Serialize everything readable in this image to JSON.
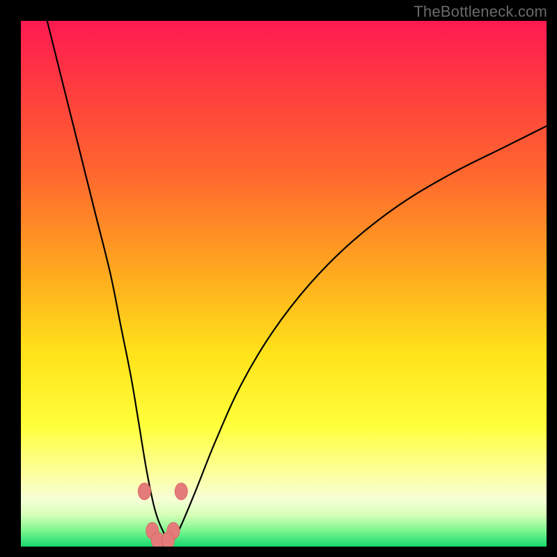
{
  "watermark": "TheBottleneck.com",
  "colors": {
    "frame": "#000000",
    "curve": "#000000",
    "marker_fill": "#e27b79",
    "marker_stroke": "#dc6866",
    "grad_stops": [
      {
        "pct": 0,
        "color": "#ff1a52"
      },
      {
        "pct": 14,
        "color": "#ff3f3d"
      },
      {
        "pct": 30,
        "color": "#ff6a2e"
      },
      {
        "pct": 48,
        "color": "#ffaa1e"
      },
      {
        "pct": 63,
        "color": "#ffe21a"
      },
      {
        "pct": 77,
        "color": "#ffff3a"
      },
      {
        "pct": 86,
        "color": "#fdff9c"
      },
      {
        "pct": 91,
        "color": "#f6ffd6"
      },
      {
        "pct": 94,
        "color": "#d6ffb7"
      },
      {
        "pct": 97,
        "color": "#7cf58f"
      },
      {
        "pct": 100,
        "color": "#16d96e"
      }
    ]
  },
  "chart_data": {
    "type": "line",
    "title": "",
    "xlabel": "",
    "ylabel": "",
    "xlim": [
      0,
      100
    ],
    "ylim": [
      0,
      100
    ],
    "grid": false,
    "series": [
      {
        "name": "bottleneck-curve",
        "x": [
          5,
          8,
          11,
          14,
          17,
          19,
          21,
          22.5,
          24,
          25.5,
          27,
          28.5,
          30,
          33,
          37,
          42,
          48,
          55,
          63,
          72,
          82,
          92,
          100
        ],
        "y": [
          100,
          88,
          76,
          64,
          52,
          42,
          32,
          23,
          14,
          7,
          3,
          1,
          3,
          10,
          20,
          31,
          41,
          50,
          58,
          65,
          71,
          76,
          80
        ]
      }
    ],
    "markers": [
      {
        "x": 23.5,
        "y": 10.5
      },
      {
        "x": 30.5,
        "y": 10.5
      },
      {
        "x": 25.0,
        "y": 3.0
      },
      {
        "x": 29.0,
        "y": 3.0
      },
      {
        "x": 26.0,
        "y": 1.2
      },
      {
        "x": 28.0,
        "y": 1.2
      }
    ]
  }
}
